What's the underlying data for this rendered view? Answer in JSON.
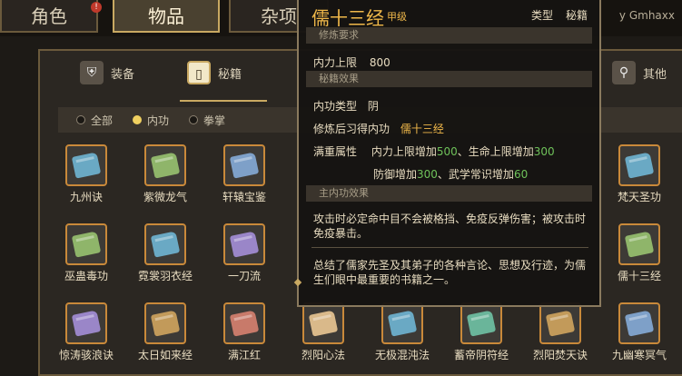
{
  "tabs": [
    {
      "label": "角色",
      "badge": "!"
    },
    {
      "label": "物品"
    },
    {
      "label": "杂项"
    }
  ],
  "credit": "y Gmhaxx",
  "categories": [
    {
      "label": "装备",
      "icon": "armor-icon"
    },
    {
      "label": "秘籍",
      "icon": "book-icon"
    },
    {
      "label": "其他",
      "icon": "misc-icon"
    }
  ],
  "filters": [
    {
      "label": "全部",
      "selected": false
    },
    {
      "label": "内功",
      "selected": true
    },
    {
      "label": "拳掌",
      "selected": false
    }
  ],
  "items": [
    {
      "label": "九州诀",
      "color": "#6aa9c4"
    },
    {
      "label": "紫微龙气",
      "color": "#8fb56a"
    },
    {
      "label": "轩辕宝鉴",
      "color": "#7ea0c8"
    },
    {
      "label": "梵天圣功",
      "color": "#6aa9c4"
    },
    {
      "label": "巫蛊毒功",
      "color": "#8fb56a"
    },
    {
      "label": "霓裳羽衣经",
      "color": "#6aa9c4"
    },
    {
      "label": "一刀流",
      "color": "#9a86c8"
    },
    {
      "label": "儒十三经",
      "color": "#8fb56a"
    },
    {
      "label": "惊涛骇浪诀",
      "color": "#9a86c8"
    },
    {
      "label": "太日如来经",
      "color": "#c29a5a"
    },
    {
      "label": "满江红",
      "color": "#c87a6a"
    },
    {
      "label": "烈阳心法",
      "color": "#d9b98a"
    },
    {
      "label": "无极混沌法",
      "color": "#6aa9c4"
    },
    {
      "label": "蓄帝阴符经",
      "color": "#6ab59a"
    },
    {
      "label": "烈阳焚天诀",
      "color": "#c29a5a"
    },
    {
      "label": "九幽寒冥气",
      "color": "#7ea0c8"
    }
  ],
  "tooltip": {
    "title": "儒十三经",
    "rank": "甲级",
    "type_label": "类型",
    "type_value": "秘籍",
    "req_header": "修炼要求",
    "req_line": "内力上限",
    "req_value": "800",
    "effect_header": "秘籍效果",
    "neigong_label": "内功类型",
    "neigong_value": "阴",
    "learn_label": "修炼后习得内功",
    "learn_value": "儒十三经",
    "full_label": "满重属性",
    "full_line1_a": "内力上限增加",
    "full_line1_b": "500",
    "full_line1_c": "、生命上限增加",
    "full_line1_d": "300",
    "full_line2_a": "防御增加",
    "full_line2_b": "300",
    "full_line2_c": "、武学常识增加",
    "full_line2_d": "60",
    "main_header": "主内功效果",
    "main_desc": "攻击时必定命中目不会被格挡、免疫反弹伤害；被攻击时免疫暴击。",
    "summary": "总结了儒家先圣及其弟子的各种言论、思想及行迹，为儒生们眼中最重要的书籍之一。"
  }
}
